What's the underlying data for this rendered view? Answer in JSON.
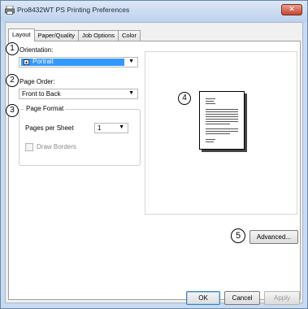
{
  "window": {
    "title": "Pro8432WT PS Printing Preferences",
    "close_glyph": "✕"
  },
  "tabs": [
    {
      "label": "Layout",
      "active": true
    },
    {
      "label": "Paper/Quality",
      "active": false
    },
    {
      "label": "Job Options",
      "active": false
    },
    {
      "label": "Color",
      "active": false
    }
  ],
  "markers": [
    "1",
    "2",
    "3",
    "4",
    "5"
  ],
  "orientation": {
    "label": "Orientation:",
    "value": "Portrait",
    "icon": "portrait-page-icon"
  },
  "page_order": {
    "label": "Page Order:",
    "value": "Front to Back"
  },
  "page_format": {
    "title": "Page Format",
    "pages_per_sheet_label": "Pages per Sheet",
    "pages_per_sheet_value": "1",
    "draw_borders_label": "Draw Borders",
    "draw_borders_checked": false
  },
  "buttons": {
    "advanced": "Advanced...",
    "ok": "OK",
    "cancel": "Cancel",
    "apply": "Apply"
  },
  "colors": {
    "selection": "#3399ff",
    "titlebar": "#c7daf0",
    "close": "#c6452f"
  }
}
